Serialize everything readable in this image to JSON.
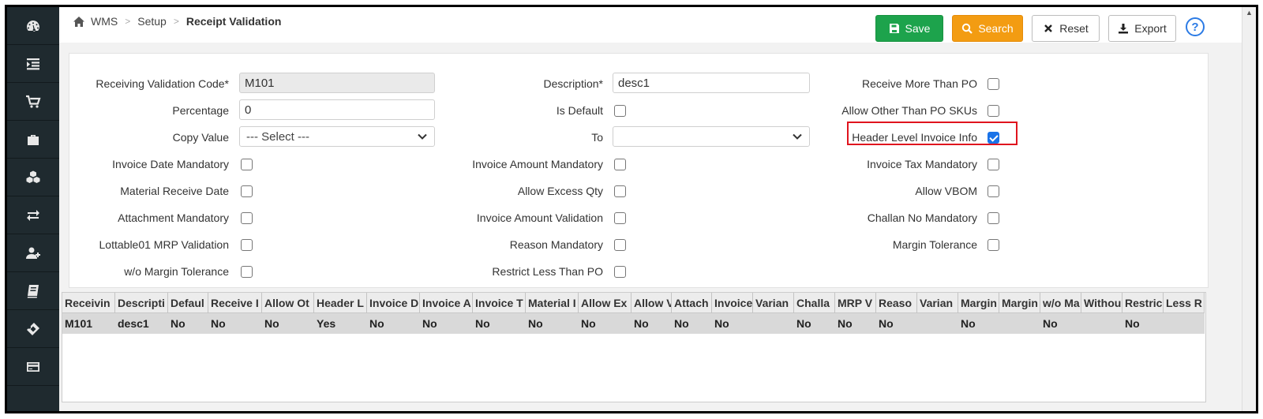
{
  "breadcrumb": {
    "items": [
      "WMS",
      "Setup"
    ],
    "current": "Receipt Validation"
  },
  "toolbar": {
    "save": "Save",
    "search": "Search",
    "reset": "Reset",
    "export": "Export",
    "help": "?"
  },
  "colors": {
    "save": "#1da34c",
    "search": "#f39c12",
    "highlight": "#e0141e",
    "checkbox_checked": "#1a73e8"
  },
  "form": {
    "receiving_validation_code": {
      "label": "Receiving Validation Code*",
      "value": "M101"
    },
    "description": {
      "label": "Description*",
      "value": "desc1"
    },
    "percentage": {
      "label": "Percentage",
      "value": "0"
    },
    "copy_value": {
      "label": "Copy Value",
      "value": "--- Select ---"
    },
    "to": {
      "label": "To",
      "value": ""
    },
    "checkboxes": {
      "receive_more_than_po": {
        "label": "Receive More Than PO",
        "checked": false
      },
      "is_default": {
        "label": "Is Default",
        "checked": false
      },
      "allow_other_than_po_skus": {
        "label": "Allow Other Than PO SKUs",
        "checked": false
      },
      "header_level_invoice_info": {
        "label": "Header Level Invoice Info",
        "checked": true
      },
      "invoice_date_mandatory": {
        "label": "Invoice Date Mandatory",
        "checked": false
      },
      "invoice_amount_mandatory": {
        "label": "Invoice Amount Mandatory",
        "checked": false
      },
      "invoice_tax_mandatory": {
        "label": "Invoice Tax Mandatory",
        "checked": false
      },
      "material_receive_date": {
        "label": "Material Receive Date",
        "checked": false
      },
      "allow_excess_qty": {
        "label": "Allow Excess Qty",
        "checked": false
      },
      "allow_vbom": {
        "label": "Allow VBOM",
        "checked": false
      },
      "attachment_mandatory": {
        "label": "Attachment Mandatory",
        "checked": false
      },
      "invoice_amount_validation": {
        "label": "Invoice Amount Validation",
        "checked": false
      },
      "challan_no_mandatory": {
        "label": "Challan No Mandatory",
        "checked": false
      },
      "lottable01_mrp_validation": {
        "label": "Lottable01 MRP Validation",
        "checked": false
      },
      "reason_mandatory": {
        "label": "Reason Mandatory",
        "checked": false
      },
      "margin_tolerance": {
        "label": "Margin Tolerance",
        "checked": false
      },
      "wo_margin_tolerance": {
        "label": "w/o Margin Tolerance",
        "checked": false
      },
      "restrict_less_than_po": {
        "label": "Restrict Less Than PO",
        "checked": false
      }
    }
  },
  "grid": {
    "headers": [
      "Receivin",
      "Descripti",
      "Defaul",
      "Receive I",
      "Allow Ot",
      "Header L",
      "Invoice D",
      "Invoice A",
      "Invoice T",
      "Material I",
      "Allow Ex",
      "Allow V",
      "Attach",
      "Invoice",
      "Varian",
      "Challa",
      "MRP V",
      "Reaso",
      "Varian",
      "Margin",
      "Margin",
      "w/o Ma",
      "Withou",
      "Restric",
      "Less R"
    ],
    "rows": [
      [
        "M101",
        "desc1",
        "No",
        "No",
        "No",
        "Yes",
        "No",
        "No",
        "No",
        "No",
        "No",
        "No",
        "No",
        "No",
        "",
        "No",
        "No",
        "No",
        "",
        "No",
        "",
        "No",
        "",
        "No",
        ""
      ]
    ]
  }
}
